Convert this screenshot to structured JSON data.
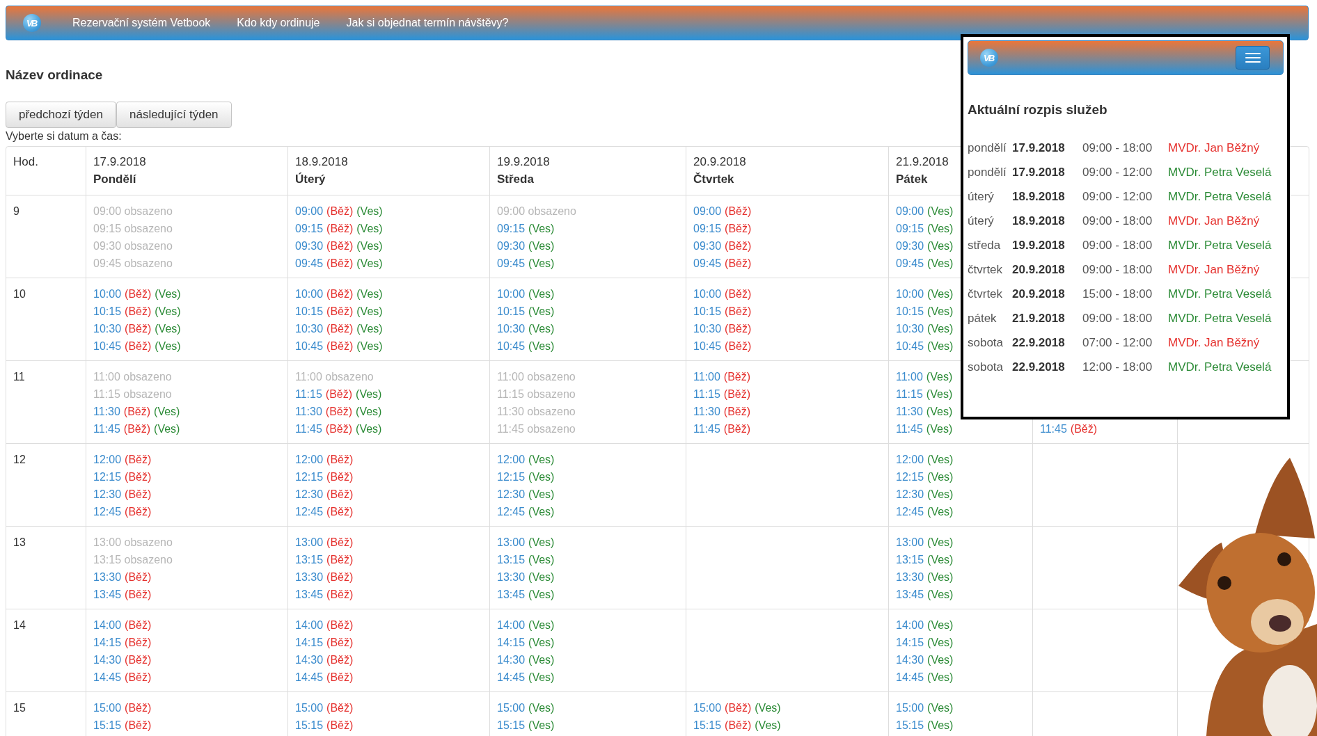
{
  "navbar": {
    "logo": "VB",
    "links": [
      "Rezervační systém Vetbook",
      "Kdo kdy ordinuje",
      "Jak si objednat termín návštěvy?"
    ]
  },
  "title": "Název ordinace",
  "week_buttons": [
    "předchozí týden",
    "následující týden"
  ],
  "instruction": "Vyberte si datum a čas:",
  "table": {
    "hour_heading": "Hod.",
    "columns": [
      {
        "date": "17.9.2018",
        "day": "Pondělí"
      },
      {
        "date": "18.9.2018",
        "day": "Úterý"
      },
      {
        "date": "19.9.2018",
        "day": "Středa"
      },
      {
        "date": "20.9.2018",
        "day": "Čtvrtek"
      },
      {
        "date": "21.9.2018",
        "day": "Pátek"
      },
      {},
      {}
    ],
    "rows": [
      {
        "hour": "9",
        "cells": [
          {
            "kind": "times",
            "slots": [
              {
                "kind": "occupied",
                "text": "09:00 obsazeno"
              },
              {
                "kind": "occupied",
                "text": "09:15 obsazeno"
              },
              {
                "kind": "occupied",
                "text": "09:30 obsazeno"
              },
              {
                "kind": "occupied",
                "text": "09:45 obsazeno"
              }
            ]
          },
          {
            "kind": "times",
            "slots": [
              {
                "kind": "available",
                "time": "09:00",
                "tags": [
                  {
                    "label": "(Běž)",
                    "color": "#e5302d"
                  },
                  {
                    "label": "(Ves)",
                    "color": "#2a8a35"
                  }
                ]
              },
              {
                "kind": "available",
                "time": "09:15",
                "tags": [
                  {
                    "label": "(Běž)",
                    "color": "#e5302d"
                  },
                  {
                    "label": "(Ves)",
                    "color": "#2a8a35"
                  }
                ]
              },
              {
                "kind": "available",
                "time": "09:30",
                "tags": [
                  {
                    "label": "(Běž)",
                    "color": "#e5302d"
                  },
                  {
                    "label": "(Ves)",
                    "color": "#2a8a35"
                  }
                ]
              },
              {
                "kind": "available",
                "time": "09:45",
                "tags": [
                  {
                    "label": "(Běž)",
                    "color": "#e5302d"
                  },
                  {
                    "label": "(Ves)",
                    "color": "#2a8a35"
                  }
                ]
              }
            ]
          },
          {
            "kind": "times",
            "slots": [
              {
                "kind": "occupied",
                "text": "09:00 obsazeno"
              },
              {
                "kind": "available",
                "time": "09:15",
                "tags": [
                  {
                    "label": "(Ves)",
                    "color": "#2a8a35"
                  }
                ]
              },
              {
                "kind": "available",
                "time": "09:30",
                "tags": [
                  {
                    "label": "(Ves)",
                    "color": "#2a8a35"
                  }
                ]
              },
              {
                "kind": "available",
                "time": "09:45",
                "tags": [
                  {
                    "label": "(Ves)",
                    "color": "#2a8a35"
                  }
                ]
              }
            ]
          },
          {
            "kind": "times",
            "slots": [
              {
                "kind": "available",
                "time": "09:00",
                "tags": [
                  {
                    "label": "(Běž)",
                    "color": "#e5302d"
                  }
                ]
              },
              {
                "kind": "available",
                "time": "09:15",
                "tags": [
                  {
                    "label": "(Běž)",
                    "color": "#e5302d"
                  }
                ]
              },
              {
                "kind": "available",
                "time": "09:30",
                "tags": [
                  {
                    "label": "(Běž)",
                    "color": "#e5302d"
                  }
                ]
              },
              {
                "kind": "available",
                "time": "09:45",
                "tags": [
                  {
                    "label": "(Běž)",
                    "color": "#e5302d"
                  }
                ]
              }
            ]
          },
          {
            "kind": "times",
            "slots": [
              {
                "kind": "available",
                "time": "09:00",
                "tags": [
                  {
                    "label": "(Ves)",
                    "color": "#2a8a35"
                  }
                ]
              },
              {
                "kind": "available",
                "time": "09:15",
                "tags": [
                  {
                    "label": "(Ves)",
                    "color": "#2a8a35"
                  }
                ]
              },
              {
                "kind": "available",
                "time": "09:30",
                "tags": [
                  {
                    "label": "(Ves)",
                    "color": "#2a8a35"
                  }
                ]
              },
              {
                "kind": "available",
                "time": "09:45",
                "tags": [
                  {
                    "label": "(Ves)",
                    "color": "#2a8a35"
                  }
                ]
              }
            ]
          },
          {
            "kind": "covered"
          },
          {
            "kind": "covered"
          }
        ]
      },
      {
        "hour": "10",
        "cells": [
          {
            "kind": "times",
            "slots": [
              {
                "kind": "available",
                "time": "10:00",
                "tags": [
                  {
                    "label": "(Běž)",
                    "color": "#e5302d"
                  },
                  {
                    "label": "(Ves)",
                    "color": "#2a8a35"
                  }
                ]
              },
              {
                "kind": "available",
                "time": "10:15",
                "tags": [
                  {
                    "label": "(Běž)",
                    "color": "#e5302d"
                  },
                  {
                    "label": "(Ves)",
                    "color": "#2a8a35"
                  }
                ]
              },
              {
                "kind": "available",
                "time": "10:30",
                "tags": [
                  {
                    "label": "(Běž)",
                    "color": "#e5302d"
                  },
                  {
                    "label": "(Ves)",
                    "color": "#2a8a35"
                  }
                ]
              },
              {
                "kind": "available",
                "time": "10:45",
                "tags": [
                  {
                    "label": "(Běž)",
                    "color": "#e5302d"
                  },
                  {
                    "label": "(Ves)",
                    "color": "#2a8a35"
                  }
                ]
              }
            ]
          },
          {
            "kind": "times",
            "slots": [
              {
                "kind": "available",
                "time": "10:00",
                "tags": [
                  {
                    "label": "(Běž)",
                    "color": "#e5302d"
                  },
                  {
                    "label": "(Ves)",
                    "color": "#2a8a35"
                  }
                ]
              },
              {
                "kind": "available",
                "time": "10:15",
                "tags": [
                  {
                    "label": "(Běž)",
                    "color": "#e5302d"
                  },
                  {
                    "label": "(Ves)",
                    "color": "#2a8a35"
                  }
                ]
              },
              {
                "kind": "available",
                "time": "10:30",
                "tags": [
                  {
                    "label": "(Běž)",
                    "color": "#e5302d"
                  },
                  {
                    "label": "(Ves)",
                    "color": "#2a8a35"
                  }
                ]
              },
              {
                "kind": "available",
                "time": "10:45",
                "tags": [
                  {
                    "label": "(Běž)",
                    "color": "#e5302d"
                  },
                  {
                    "label": "(Ves)",
                    "color": "#2a8a35"
                  }
                ]
              }
            ]
          },
          {
            "kind": "times",
            "slots": [
              {
                "kind": "available",
                "time": "10:00",
                "tags": [
                  {
                    "label": "(Ves)",
                    "color": "#2a8a35"
                  }
                ]
              },
              {
                "kind": "available",
                "time": "10:15",
                "tags": [
                  {
                    "label": "(Ves)",
                    "color": "#2a8a35"
                  }
                ]
              },
              {
                "kind": "available",
                "time": "10:30",
                "tags": [
                  {
                    "label": "(Ves)",
                    "color": "#2a8a35"
                  }
                ]
              },
              {
                "kind": "available",
                "time": "10:45",
                "tags": [
                  {
                    "label": "(Ves)",
                    "color": "#2a8a35"
                  }
                ]
              }
            ]
          },
          {
            "kind": "times",
            "slots": [
              {
                "kind": "available",
                "time": "10:00",
                "tags": [
                  {
                    "label": "(Běž)",
                    "color": "#e5302d"
                  }
                ]
              },
              {
                "kind": "available",
                "time": "10:15",
                "tags": [
                  {
                    "label": "(Běž)",
                    "color": "#e5302d"
                  }
                ]
              },
              {
                "kind": "available",
                "time": "10:30",
                "tags": [
                  {
                    "label": "(Běž)",
                    "color": "#e5302d"
                  }
                ]
              },
              {
                "kind": "available",
                "time": "10:45",
                "tags": [
                  {
                    "label": "(Běž)",
                    "color": "#e5302d"
                  }
                ]
              }
            ]
          },
          {
            "kind": "times",
            "slots": [
              {
                "kind": "available",
                "time": "10:00",
                "tags": [
                  {
                    "label": "(Ves)",
                    "color": "#2a8a35"
                  }
                ]
              },
              {
                "kind": "available",
                "time": "10:15",
                "tags": [
                  {
                    "label": "(Ves)",
                    "color": "#2a8a35"
                  }
                ]
              },
              {
                "kind": "available",
                "time": "10:30",
                "tags": [
                  {
                    "label": "(Ves)",
                    "color": "#2a8a35"
                  }
                ]
              },
              {
                "kind": "available",
                "time": "10:45",
                "tags": [
                  {
                    "label": "(Ves)",
                    "color": "#2a8a35"
                  }
                ]
              }
            ]
          },
          {
            "kind": "covered"
          },
          {
            "kind": "covered"
          }
        ]
      },
      {
        "hour": "11",
        "cells": [
          {
            "kind": "times",
            "slots": [
              {
                "kind": "occupied",
                "text": "11:00 obsazeno"
              },
              {
                "kind": "occupied",
                "text": "11:15 obsazeno"
              },
              {
                "kind": "available",
                "time": "11:30",
                "tags": [
                  {
                    "label": "(Běž)",
                    "color": "#e5302d"
                  },
                  {
                    "label": "(Ves)",
                    "color": "#2a8a35"
                  }
                ]
              },
              {
                "kind": "available",
                "time": "11:45",
                "tags": [
                  {
                    "label": "(Běž)",
                    "color": "#e5302d"
                  },
                  {
                    "label": "(Ves)",
                    "color": "#2a8a35"
                  }
                ]
              }
            ]
          },
          {
            "kind": "times",
            "slots": [
              {
                "kind": "occupied",
                "text": "11:00 obsazeno"
              },
              {
                "kind": "available",
                "time": "11:15",
                "tags": [
                  {
                    "label": "(Běž)",
                    "color": "#e5302d"
                  },
                  {
                    "label": "(Ves)",
                    "color": "#2a8a35"
                  }
                ]
              },
              {
                "kind": "available",
                "time": "11:30",
                "tags": [
                  {
                    "label": "(Běž)",
                    "color": "#e5302d"
                  },
                  {
                    "label": "(Ves)",
                    "color": "#2a8a35"
                  }
                ]
              },
              {
                "kind": "available",
                "time": "11:45",
                "tags": [
                  {
                    "label": "(Běž)",
                    "color": "#e5302d"
                  },
                  {
                    "label": "(Ves)",
                    "color": "#2a8a35"
                  }
                ]
              }
            ]
          },
          {
            "kind": "times",
            "slots": [
              {
                "kind": "occupied",
                "text": "11:00 obsazeno"
              },
              {
                "kind": "occupied",
                "text": "11:15 obsazeno"
              },
              {
                "kind": "occupied",
                "text": "11:30 obsazeno"
              },
              {
                "kind": "occupied",
                "text": "11:45 obsazeno"
              }
            ]
          },
          {
            "kind": "times",
            "slots": [
              {
                "kind": "available",
                "time": "11:00",
                "tags": [
                  {
                    "label": "(Běž)",
                    "color": "#e5302d"
                  }
                ]
              },
              {
                "kind": "available",
                "time": "11:15",
                "tags": [
                  {
                    "label": "(Běž)",
                    "color": "#e5302d"
                  }
                ]
              },
              {
                "kind": "available",
                "time": "11:30",
                "tags": [
                  {
                    "label": "(Běž)",
                    "color": "#e5302d"
                  }
                ]
              },
              {
                "kind": "available",
                "time": "11:45",
                "tags": [
                  {
                    "label": "(Běž)",
                    "color": "#e5302d"
                  }
                ]
              }
            ]
          },
          {
            "kind": "times",
            "slots": [
              {
                "kind": "available",
                "time": "11:00",
                "tags": [
                  {
                    "label": "(Ves)",
                    "color": "#2a8a35"
                  }
                ]
              },
              {
                "kind": "available",
                "time": "11:15",
                "tags": [
                  {
                    "label": "(Ves)",
                    "color": "#2a8a35"
                  }
                ]
              },
              {
                "kind": "available",
                "time": "11:30",
                "tags": [
                  {
                    "label": "(Ves)",
                    "color": "#2a8a35"
                  }
                ]
              },
              {
                "kind": "available",
                "time": "11:45",
                "tags": [
                  {
                    "label": "(Ves)",
                    "color": "#2a8a35"
                  }
                ]
              }
            ]
          },
          {
            "kind": "times",
            "slots": [
              {
                "kind": "covered"
              },
              {
                "kind": "covered"
              },
              {
                "kind": "covered"
              },
              {
                "kind": "available",
                "time": "11:45",
                "tags": [
                  {
                    "label": "(Běž)",
                    "color": "#e5302d"
                  }
                ]
              }
            ]
          },
          {
            "kind": "covered"
          }
        ]
      },
      {
        "hour": "12",
        "cells": [
          {
            "kind": "times",
            "slots": [
              {
                "kind": "available",
                "time": "12:00",
                "tags": [
                  {
                    "label": "(Běž)",
                    "color": "#e5302d"
                  }
                ]
              },
              {
                "kind": "available",
                "time": "12:15",
                "tags": [
                  {
                    "label": "(Běž)",
                    "color": "#e5302d"
                  }
                ]
              },
              {
                "kind": "available",
                "time": "12:30",
                "tags": [
                  {
                    "label": "(Běž)",
                    "color": "#e5302d"
                  }
                ]
              },
              {
                "kind": "available",
                "time": "12:45",
                "tags": [
                  {
                    "label": "(Běž)",
                    "color": "#e5302d"
                  }
                ]
              }
            ]
          },
          {
            "kind": "times",
            "slots": [
              {
                "kind": "available",
                "time": "12:00",
                "tags": [
                  {
                    "label": "(Běž)",
                    "color": "#e5302d"
                  }
                ]
              },
              {
                "kind": "available",
                "time": "12:15",
                "tags": [
                  {
                    "label": "(Běž)",
                    "color": "#e5302d"
                  }
                ]
              },
              {
                "kind": "available",
                "time": "12:30",
                "tags": [
                  {
                    "label": "(Běž)",
                    "color": "#e5302d"
                  }
                ]
              },
              {
                "kind": "available",
                "time": "12:45",
                "tags": [
                  {
                    "label": "(Běž)",
                    "color": "#e5302d"
                  }
                ]
              }
            ]
          },
          {
            "kind": "times",
            "slots": [
              {
                "kind": "available",
                "time": "12:00",
                "tags": [
                  {
                    "label": "(Ves)",
                    "color": "#2a8a35"
                  }
                ]
              },
              {
                "kind": "available",
                "time": "12:15",
                "tags": [
                  {
                    "label": "(Ves)",
                    "color": "#2a8a35"
                  }
                ]
              },
              {
                "kind": "available",
                "time": "12:30",
                "tags": [
                  {
                    "label": "(Ves)",
                    "color": "#2a8a35"
                  }
                ]
              },
              {
                "kind": "available",
                "time": "12:45",
                "tags": [
                  {
                    "label": "(Ves)",
                    "color": "#2a8a35"
                  }
                ]
              }
            ]
          },
          {
            "kind": "empty"
          },
          {
            "kind": "times",
            "slots": [
              {
                "kind": "available",
                "time": "12:00",
                "tags": [
                  {
                    "label": "(Ves)",
                    "color": "#2a8a35"
                  }
                ]
              },
              {
                "kind": "available",
                "time": "12:15",
                "tags": [
                  {
                    "label": "(Ves)",
                    "color": "#2a8a35"
                  }
                ]
              },
              {
                "kind": "available",
                "time": "12:30",
                "tags": [
                  {
                    "label": "(Ves)",
                    "color": "#2a8a35"
                  }
                ]
              },
              {
                "kind": "available",
                "time": "12:45",
                "tags": [
                  {
                    "label": "(Ves)",
                    "color": "#2a8a35"
                  }
                ]
              }
            ]
          },
          {
            "kind": "empty"
          },
          {
            "kind": "covered"
          }
        ]
      },
      {
        "hour": "13",
        "cells": [
          {
            "kind": "times",
            "slots": [
              {
                "kind": "occupied",
                "text": "13:00 obsazeno"
              },
              {
                "kind": "occupied",
                "text": "13:15 obsazeno"
              },
              {
                "kind": "available",
                "time": "13:30",
                "tags": [
                  {
                    "label": "(Běž)",
                    "color": "#e5302d"
                  }
                ]
              },
              {
                "kind": "available",
                "time": "13:45",
                "tags": [
                  {
                    "label": "(Běž)",
                    "color": "#e5302d"
                  }
                ]
              }
            ]
          },
          {
            "kind": "times",
            "slots": [
              {
                "kind": "available",
                "time": "13:00",
                "tags": [
                  {
                    "label": "(Běž)",
                    "color": "#e5302d"
                  }
                ]
              },
              {
                "kind": "available",
                "time": "13:15",
                "tags": [
                  {
                    "label": "(Běž)",
                    "color": "#e5302d"
                  }
                ]
              },
              {
                "kind": "available",
                "time": "13:30",
                "tags": [
                  {
                    "label": "(Běž)",
                    "color": "#e5302d"
                  }
                ]
              },
              {
                "kind": "available",
                "time": "13:45",
                "tags": [
                  {
                    "label": "(Běž)",
                    "color": "#e5302d"
                  }
                ]
              }
            ]
          },
          {
            "kind": "times",
            "slots": [
              {
                "kind": "available",
                "time": "13:00",
                "tags": [
                  {
                    "label": "(Ves)",
                    "color": "#2a8a35"
                  }
                ]
              },
              {
                "kind": "available",
                "time": "13:15",
                "tags": [
                  {
                    "label": "(Ves)",
                    "color": "#2a8a35"
                  }
                ]
              },
              {
                "kind": "available",
                "time": "13:30",
                "tags": [
                  {
                    "label": "(Ves)",
                    "color": "#2a8a35"
                  }
                ]
              },
              {
                "kind": "available",
                "time": "13:45",
                "tags": [
                  {
                    "label": "(Ves)",
                    "color": "#2a8a35"
                  }
                ]
              }
            ]
          },
          {
            "kind": "empty"
          },
          {
            "kind": "times",
            "slots": [
              {
                "kind": "available",
                "time": "13:00",
                "tags": [
                  {
                    "label": "(Ves)",
                    "color": "#2a8a35"
                  }
                ]
              },
              {
                "kind": "available",
                "time": "13:15",
                "tags": [
                  {
                    "label": "(Ves)",
                    "color": "#2a8a35"
                  }
                ]
              },
              {
                "kind": "available",
                "time": "13:30",
                "tags": [
                  {
                    "label": "(Ves)",
                    "color": "#2a8a35"
                  }
                ]
              },
              {
                "kind": "available",
                "time": "13:45",
                "tags": [
                  {
                    "label": "(Ves)",
                    "color": "#2a8a35"
                  }
                ]
              }
            ]
          },
          {
            "kind": "empty"
          },
          {
            "kind": "covered"
          }
        ]
      },
      {
        "hour": "14",
        "cells": [
          {
            "kind": "times",
            "slots": [
              {
                "kind": "available",
                "time": "14:00",
                "tags": [
                  {
                    "label": "(Běž)",
                    "color": "#e5302d"
                  }
                ]
              },
              {
                "kind": "available",
                "time": "14:15",
                "tags": [
                  {
                    "label": "(Běž)",
                    "color": "#e5302d"
                  }
                ]
              },
              {
                "kind": "available",
                "time": "14:30",
                "tags": [
                  {
                    "label": "(Běž)",
                    "color": "#e5302d"
                  }
                ]
              },
              {
                "kind": "available",
                "time": "14:45",
                "tags": [
                  {
                    "label": "(Běž)",
                    "color": "#e5302d"
                  }
                ]
              }
            ]
          },
          {
            "kind": "times",
            "slots": [
              {
                "kind": "available",
                "time": "14:00",
                "tags": [
                  {
                    "label": "(Běž)",
                    "color": "#e5302d"
                  }
                ]
              },
              {
                "kind": "available",
                "time": "14:15",
                "tags": [
                  {
                    "label": "(Běž)",
                    "color": "#e5302d"
                  }
                ]
              },
              {
                "kind": "available",
                "time": "14:30",
                "tags": [
                  {
                    "label": "(Běž)",
                    "color": "#e5302d"
                  }
                ]
              },
              {
                "kind": "available",
                "time": "14:45",
                "tags": [
                  {
                    "label": "(Běž)",
                    "color": "#e5302d"
                  }
                ]
              }
            ]
          },
          {
            "kind": "times",
            "slots": [
              {
                "kind": "available",
                "time": "14:00",
                "tags": [
                  {
                    "label": "(Ves)",
                    "color": "#2a8a35"
                  }
                ]
              },
              {
                "kind": "available",
                "time": "14:15",
                "tags": [
                  {
                    "label": "(Ves)",
                    "color": "#2a8a35"
                  }
                ]
              },
              {
                "kind": "available",
                "time": "14:30",
                "tags": [
                  {
                    "label": "(Ves)",
                    "color": "#2a8a35"
                  }
                ]
              },
              {
                "kind": "available",
                "time": "14:45",
                "tags": [
                  {
                    "label": "(Ves)",
                    "color": "#2a8a35"
                  }
                ]
              }
            ]
          },
          {
            "kind": "empty"
          },
          {
            "kind": "times",
            "slots": [
              {
                "kind": "available",
                "time": "14:00",
                "tags": [
                  {
                    "label": "(Ves)",
                    "color": "#2a8a35"
                  }
                ]
              },
              {
                "kind": "available",
                "time": "14:15",
                "tags": [
                  {
                    "label": "(Ves)",
                    "color": "#2a8a35"
                  }
                ]
              },
              {
                "kind": "available",
                "time": "14:30",
                "tags": [
                  {
                    "label": "(Ves)",
                    "color": "#2a8a35"
                  }
                ]
              },
              {
                "kind": "available",
                "time": "14:45",
                "tags": [
                  {
                    "label": "(Ves)",
                    "color": "#2a8a35"
                  }
                ]
              }
            ]
          },
          {
            "kind": "empty"
          },
          {
            "kind": "covered"
          }
        ]
      },
      {
        "hour": "15",
        "cells": [
          {
            "kind": "times",
            "slots": [
              {
                "kind": "available",
                "time": "15:00",
                "tags": [
                  {
                    "label": "(Běž)",
                    "color": "#e5302d"
                  }
                ]
              },
              {
                "kind": "available",
                "time": "15:15",
                "tags": [
                  {
                    "label": "(Běž)",
                    "color": "#e5302d"
                  }
                ]
              }
            ]
          },
          {
            "kind": "times",
            "slots": [
              {
                "kind": "available",
                "time": "15:00",
                "tags": [
                  {
                    "label": "(Běž)",
                    "color": "#e5302d"
                  }
                ]
              },
              {
                "kind": "available",
                "time": "15:15",
                "tags": [
                  {
                    "label": "(Běž)",
                    "color": "#e5302d"
                  }
                ]
              }
            ]
          },
          {
            "kind": "times",
            "slots": [
              {
                "kind": "available",
                "time": "15:00",
                "tags": [
                  {
                    "label": "(Ves)",
                    "color": "#2a8a35"
                  }
                ]
              },
              {
                "kind": "available",
                "time": "15:15",
                "tags": [
                  {
                    "label": "(Ves)",
                    "color": "#2a8a35"
                  }
                ]
              }
            ]
          },
          {
            "kind": "times",
            "slots": [
              {
                "kind": "available",
                "time": "15:00",
                "tags": [
                  {
                    "label": "(Běž)",
                    "color": "#e5302d"
                  },
                  {
                    "label": "(Ves)",
                    "color": "#2a8a35"
                  }
                ]
              },
              {
                "kind": "available",
                "time": "15:15",
                "tags": [
                  {
                    "label": "(Běž)",
                    "color": "#e5302d"
                  },
                  {
                    "label": "(Ves)",
                    "color": "#2a8a35"
                  }
                ]
              }
            ]
          },
          {
            "kind": "times",
            "slots": [
              {
                "kind": "available",
                "time": "15:00",
                "tags": [
                  {
                    "label": "(Ves)",
                    "color": "#2a8a35"
                  }
                ]
              },
              {
                "kind": "available",
                "time": "15:15",
                "tags": [
                  {
                    "label": "(Ves)",
                    "color": "#2a8a35"
                  }
                ]
              }
            ]
          },
          {
            "kind": "empty"
          },
          {
            "kind": "covered"
          }
        ]
      }
    ]
  },
  "popup": {
    "navbar": {
      "logo": "VB"
    },
    "title": "Aktuální rozpis služeb",
    "schedule": [
      {
        "day": "pondělí",
        "date": "17.9.2018",
        "hours": "09:00 - 18:00",
        "doctor": "MVDr. Jan Běžný",
        "color": "#e5302d"
      },
      {
        "day": "pondělí",
        "date": "17.9.2018",
        "hours": "09:00 - 12:00",
        "doctor": "MVDr. Petra Veselá",
        "color": "#2a8a35"
      },
      {
        "day": "úterý",
        "date": "18.9.2018",
        "hours": "09:00 - 12:00",
        "doctor": "MVDr. Petra Veselá",
        "color": "#2a8a35"
      },
      {
        "day": "úterý",
        "date": "18.9.2018",
        "hours": "09:00 - 18:00",
        "doctor": "MVDr. Jan Běžný",
        "color": "#e5302d"
      },
      {
        "day": "středa",
        "date": "19.9.2018",
        "hours": "09:00 - 18:00",
        "doctor": "MVDr. Petra Veselá",
        "color": "#2a8a35"
      },
      {
        "day": "čtvrtek",
        "date": "20.9.2018",
        "hours": "09:00 - 18:00",
        "doctor": "MVDr. Jan Běžný",
        "color": "#e5302d"
      },
      {
        "day": "čtvrtek",
        "date": "20.9.2018",
        "hours": "15:00 - 18:00",
        "doctor": "MVDr. Petra Veselá",
        "color": "#2a8a35"
      },
      {
        "day": "pátek",
        "date": "21.9.2018",
        "hours": "09:00 - 18:00",
        "doctor": "MVDr. Petra Veselá",
        "color": "#2a8a35"
      },
      {
        "day": "sobota",
        "date": "22.9.2018",
        "hours": "07:00 - 12:00",
        "doctor": "MVDr. Jan Běžný",
        "color": "#e5302d"
      },
      {
        "day": "sobota",
        "date": "22.9.2018",
        "hours": "12:00 - 18:00",
        "doctor": "MVDr. Petra Veselá",
        "color": "#2a8a35"
      }
    ]
  }
}
